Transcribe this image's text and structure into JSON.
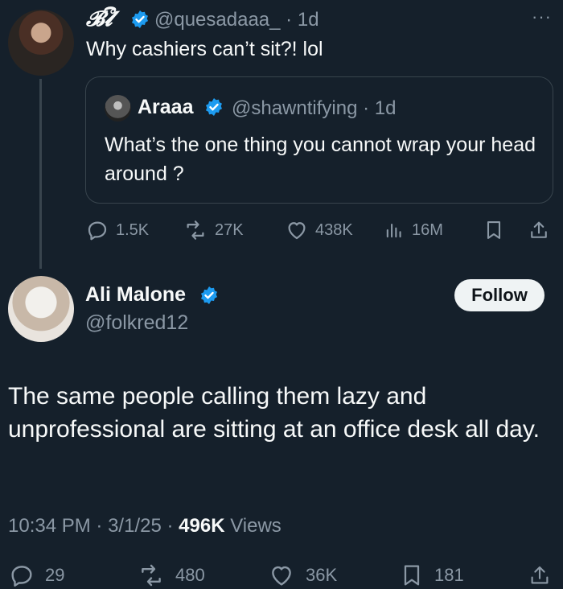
{
  "tweet1": {
    "display_name": "𝓑𝓵ී",
    "handle": "@quesadaaa_",
    "time": "1d",
    "text": "Why cashiers can’t sit?! lol",
    "more": "···",
    "quote": {
      "display_name": "Araaa",
      "handle": "@shawntifying",
      "time": "1d",
      "text": "What’s the one thing you cannot wrap your head around ?"
    },
    "stats": {
      "replies": "1.5K",
      "reposts": "27K",
      "likes": "438K",
      "views": "16M"
    }
  },
  "tweet2": {
    "display_name": "Ali Malone",
    "handle": "@folkred12",
    "follow_label": "Follow",
    "text": "The same people calling them lazy and unprofessional are sitting at an office desk all day.",
    "time": "10:34 PM",
    "date": "3/1/25",
    "views_count": "496K",
    "views_label": "Views",
    "stats": {
      "replies": "29",
      "reposts": "480",
      "likes": "36K",
      "bookmarks": "181"
    }
  },
  "colors": {
    "background": "#15202b",
    "verified": "#1d9bf0",
    "muted": "#8b98a5"
  }
}
